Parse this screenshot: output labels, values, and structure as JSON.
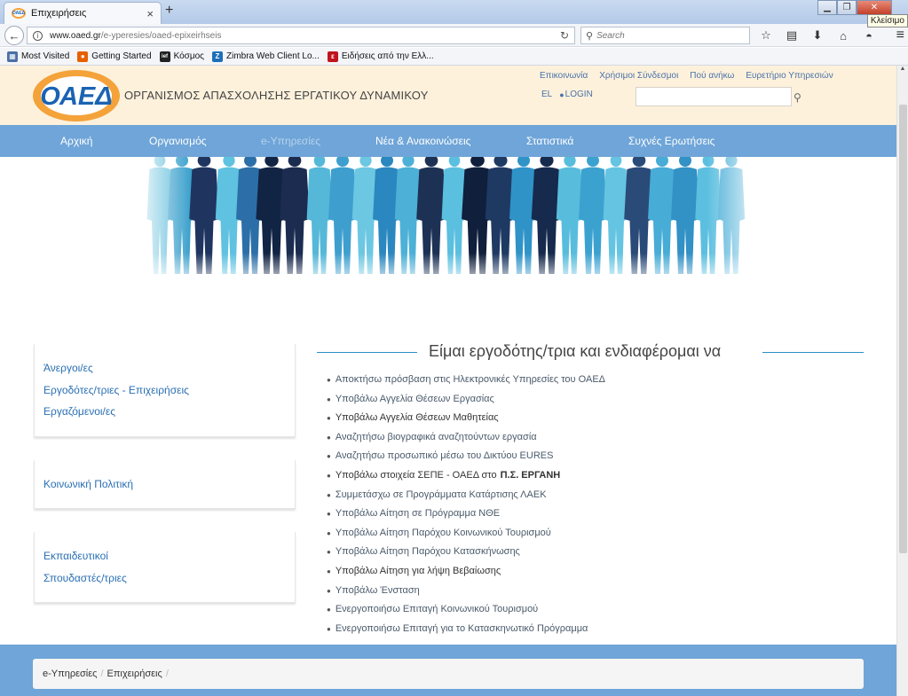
{
  "browser": {
    "tab_title": "Επιχειρήσεις",
    "tab_close": "×",
    "new_tab": "+",
    "tooltip": "Κλείσιμο",
    "url_host": "www.oaed.gr",
    "url_path": "/e-yperesies/oaed-epixeirhseis",
    "search_placeholder": "Search",
    "bookmarks": [
      {
        "label": "Most Visited",
        "icon": "most-visited-icon",
        "color": "#4a6fa5"
      },
      {
        "label": "Getting Started",
        "icon": "firefox-icon",
        "color": "#e66000"
      },
      {
        "label": "Κόσμος",
        "icon": "ief-icon",
        "color": "#222222"
      },
      {
        "label": "Zimbra Web Client Lo...",
        "icon": "zimbra-icon",
        "color": "#1d6fb8"
      },
      {
        "label": "Ειδήσεις από την Ελλ...",
        "icon": "news-icon",
        "color": "#c0141e"
      }
    ]
  },
  "site": {
    "logo_text": "ΟΑΕΔ",
    "org_name": "ΟΡΓΑΝΙΣΜΟΣ ΑΠΑΣΧΟΛΗΣΗΣ ΕΡΓΑΤΙΚΟΥ ΔΥΝΑΜΙΚΟΥ",
    "top_links": [
      "Επικοινωνία",
      "Χρήσιμοι Σύνδεσμοι",
      "Πού ανήκω",
      "Ευρετήριο Υπηρεσιών"
    ],
    "lang": "EL",
    "login": "LOGIN",
    "nav": [
      "Αρχική",
      "Οργανισμός",
      "e-Υπηρεσίες",
      "Νέα & Ανακοινώσεις",
      "Στατιστικά",
      "Συχνές Ερωτήσεις"
    ],
    "colors": {
      "header_bg": "#fdf1dc",
      "nav_bg": "#6fa5d8",
      "link": "#2a6fb3",
      "logo_orange": "#f4a23a",
      "logo_blue": "#1a63b3"
    }
  },
  "sidebar": {
    "group1": [
      "Άνεργοι/ες",
      "Εργοδότες/τριες - Επιχειρήσεις",
      "Εργαζόμενοι/ες"
    ],
    "group2": [
      "Κοινωνική Πολιτική"
    ],
    "group3": [
      "Εκπαιδευτικοί",
      "Σπουδαστές/τριες"
    ]
  },
  "main": {
    "title": "Είμαι εργοδότης/τρια και ενδιαφέρομαι να",
    "services": [
      "Αποκτήσω πρόσβαση στις Ηλεκτρονικές Υπηρεσίες του ΟΑΕΔ",
      "Υποβάλω Αγγελία Θέσεων Εργασίας",
      "Υποβάλω Αγγελία Θέσεων Μαθητείας",
      "Αναζητήσω βιογραφικά αναζητούντων εργασία",
      "Αναζητήσω προσωπικό μέσω του Δικτύου EURES",
      "Υποβάλω στοιχεία ΣΕΠΕ - ΟΑΕΔ στο",
      "Συμμετάσχω σε Προγράμματα Κατάρτισης ΛΑΕΚ",
      "Υποβάλω Αίτηση σε Πρόγραμμα ΝΘΕ",
      "Υποβάλω Αίτηση Παρόχου Κοινωνικού Τουρισμού",
      "Υποβάλω Αίτηση Παρόχου Κατασκήνωσης",
      "Υποβάλω Αίτηση για λήψη Βεβαίωσης",
      "Υποβάλω  Ένσταση",
      "Ενεργοποιήσω Επιταγή Κοινωνικού Τουρισμού",
      "Ενεργοποιήσω Επιταγή για το Κατασκηνωτικό Πρόγραμμα"
    ],
    "service_bold_suffix": "Π.Σ. ΕΡΓΑΝΗ"
  },
  "footer": {
    "breadcrumb": [
      "e-Υπηρεσίες",
      "Επιχειρήσεις"
    ],
    "separator": "/"
  }
}
